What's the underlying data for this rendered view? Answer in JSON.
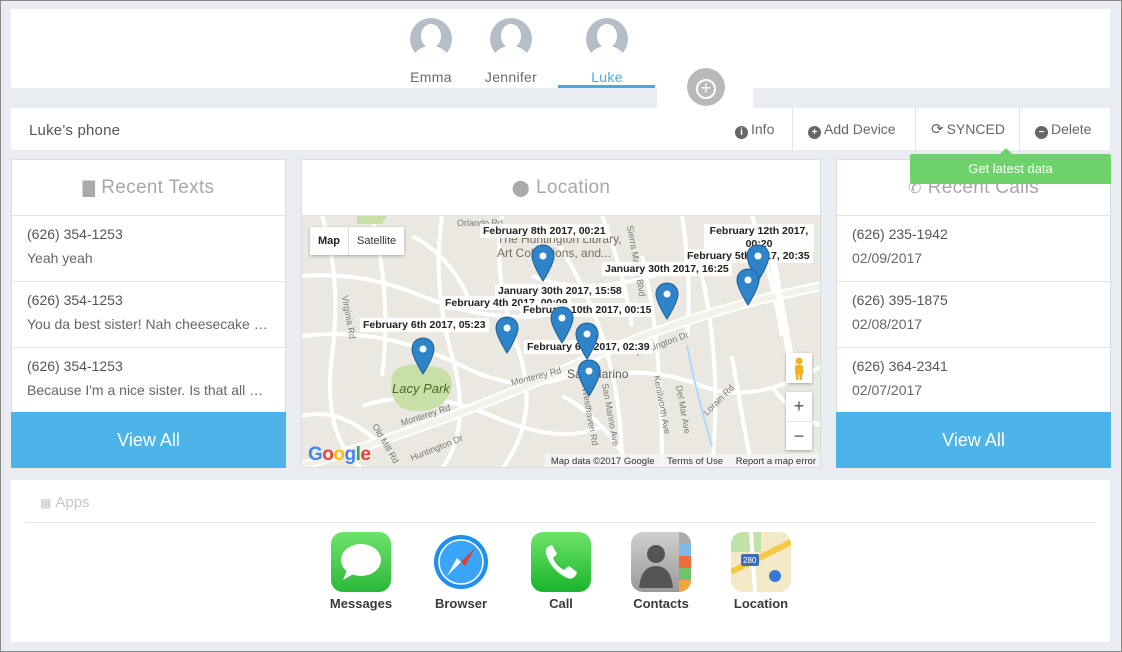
{
  "profiles": [
    {
      "name": "Emma",
      "active": false
    },
    {
      "name": "Jennifer",
      "active": false
    },
    {
      "name": "Luke",
      "active": true
    }
  ],
  "device": {
    "name": "Luke's phone",
    "actions": {
      "info": "Info",
      "add_device": "Add Device",
      "synced": "SYNCED",
      "delete": "Delete"
    },
    "tooltip": "Get latest data"
  },
  "texts": {
    "title": "Recent Texts",
    "items": [
      {
        "number": "(626) 354-1253",
        "message": "Yeah yeah"
      },
      {
        "number": "(626) 354-1253",
        "message": "You da best sister! Nah cheesecake sounds good"
      },
      {
        "number": "(626) 354-1253",
        "message": "Because I'm a nice sister. Is that all you wanted?"
      }
    ],
    "view_all": "View All"
  },
  "location": {
    "title": "Location",
    "map_type": {
      "map": "Map",
      "satellite": "Satellite"
    },
    "markers": [
      "February 8th 2017, 00:21",
      "February 12th 2017, 00:20",
      "February 5th 2017, 20:35",
      "January 30th 2017, 16:25",
      "January 30th 2017, 15:58",
      "February 4th 2017, 00:09",
      "February 10th 2017, 00:15",
      "February 6th 2017, 05:23",
      "February 6th 2017, 02:39"
    ],
    "places": [
      "The Huntington Library, Art Collections, and...",
      "Lacy Park",
      "San Marino",
      "Huntington Dr",
      "Monterey Rd",
      "Del Mar Ave",
      "Lorain Rd",
      "San Marino Ave",
      "Kenilworth Ave",
      "Westhaven Rd",
      "Orlando Rd",
      "Virginia Rd",
      "Old Mill Rd",
      "Sierra Madre Blvd"
    ],
    "footer": {
      "data": "Map data ©2017 Google",
      "terms": "Terms of Use",
      "report": "Report a map error"
    },
    "google": "Google"
  },
  "calls": {
    "title": "Recent Calls",
    "items": [
      {
        "number": "(626) 235-1942",
        "date": "02/09/2017"
      },
      {
        "number": "(626) 395-1875",
        "date": "02/08/2017"
      },
      {
        "number": "(626) 364-2341",
        "date": "02/07/2017"
      }
    ],
    "view_all": "View All"
  },
  "apps": {
    "title": "Apps",
    "items": [
      {
        "label": "Messages",
        "icon": "messages-icon"
      },
      {
        "label": "Browser",
        "icon": "browser-icon"
      },
      {
        "label": "Call",
        "icon": "call-icon"
      },
      {
        "label": "Contacts",
        "icon": "contacts-icon"
      },
      {
        "label": "Location",
        "icon": "location-map-icon"
      }
    ]
  },
  "colors": {
    "accent": "#4db4ea",
    "sync_tooltip": "#6dd36a",
    "pin": "#2d84c8"
  }
}
